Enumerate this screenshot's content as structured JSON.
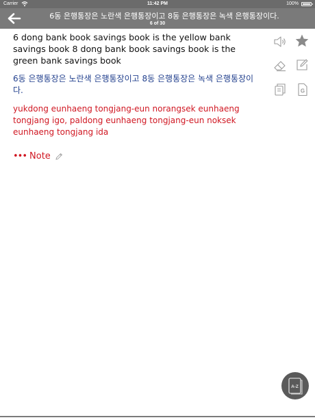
{
  "status_bar": {
    "carrier": "Carrier",
    "time": "11:42 PM",
    "battery": "100%"
  },
  "nav": {
    "title": "6동 은행통장은 노란색 은행통장이고 8동 은행통장은 녹색 은행통장이다.",
    "counter": "6 of 30"
  },
  "phrase": {
    "english": "6 dong bank book savings book is the yellow bank savings book 8 dong bank book savings book is the green bank savings book",
    "korean": "6동 은행통장은 노란색 은행통장이고 8동 은행통장은 녹색 은행통장이다.",
    "romanization": "yukdong eunhaeng tongjang-eun norangsek eunhaeng tongjang igo, paldong eunhaeng tongjang-eun noksek eunhaeng tongjang ida"
  },
  "note": {
    "dots": "•••",
    "label": "Note"
  },
  "icons": {
    "back": "back-arrow-icon",
    "speaker": "speaker-icon",
    "favorite": "star-icon",
    "eraser": "eraser-icon",
    "edit": "edit-icon",
    "copy": "copy-icon",
    "google": "google-icon",
    "pencil": "pencil-icon",
    "az": "az-dictionary-icon"
  },
  "colors": {
    "nav_bg": "#7a7a7a",
    "english_text": "#111111",
    "korean_text": "#23418e",
    "romanization_text": "#d01722",
    "icon_gray": "#9a9a9a"
  }
}
